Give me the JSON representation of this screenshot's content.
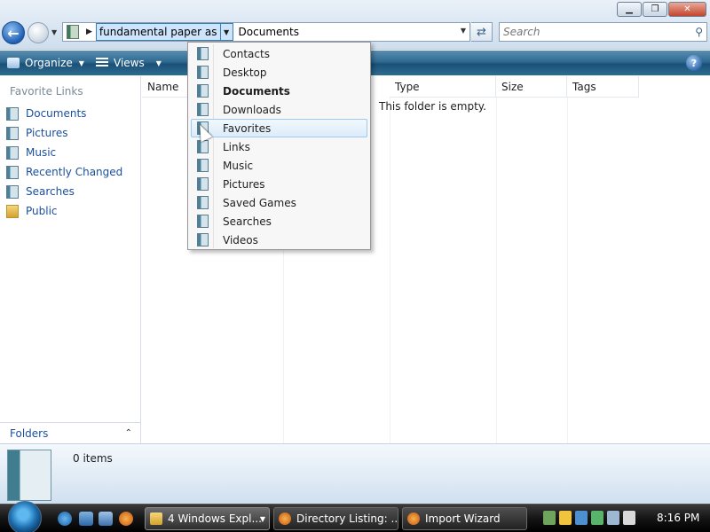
{
  "window": {
    "min_label": "▁",
    "max_label": "❐",
    "close_label": "✕"
  },
  "address": {
    "selected_crumb": "fundamental paper as",
    "current_crumb": "Documents"
  },
  "search": {
    "placeholder": "Search"
  },
  "toolbar": {
    "organize_label": "Organize",
    "views_label": "Views",
    "help_label": "?"
  },
  "nav": {
    "favorite_links_title": "Favorite Links",
    "items": [
      {
        "label": "Documents",
        "icon": "documents-icon"
      },
      {
        "label": "Pictures",
        "icon": "pictures-icon"
      },
      {
        "label": "Music",
        "icon": "music-icon"
      },
      {
        "label": "Recently Changed",
        "icon": "recently-changed-icon"
      },
      {
        "label": "Searches",
        "icon": "searches-icon"
      },
      {
        "label": "Public",
        "icon": "public-folder-icon"
      }
    ],
    "folders_label": "Folders"
  },
  "columns": {
    "name": "Name",
    "type": "Type",
    "size": "Size",
    "tags": "Tags"
  },
  "content": {
    "empty_message": "This folder is empty."
  },
  "dropdown": {
    "items": [
      {
        "label": "Contacts"
      },
      {
        "label": "Desktop"
      },
      {
        "label": "Documents"
      },
      {
        "label": "Downloads"
      },
      {
        "label": "Favorites"
      },
      {
        "label": "Links"
      },
      {
        "label": "Music"
      },
      {
        "label": "Pictures"
      },
      {
        "label": "Saved Games"
      },
      {
        "label": "Searches"
      },
      {
        "label": "Videos"
      }
    ]
  },
  "details": {
    "item_count": "0 items"
  },
  "taskbar": {
    "tasks": [
      {
        "label": "4 Windows Expl..."
      },
      {
        "label": "Directory Listing: ..."
      },
      {
        "label": "Import Wizard"
      }
    ],
    "clock": "8:16 PM"
  }
}
